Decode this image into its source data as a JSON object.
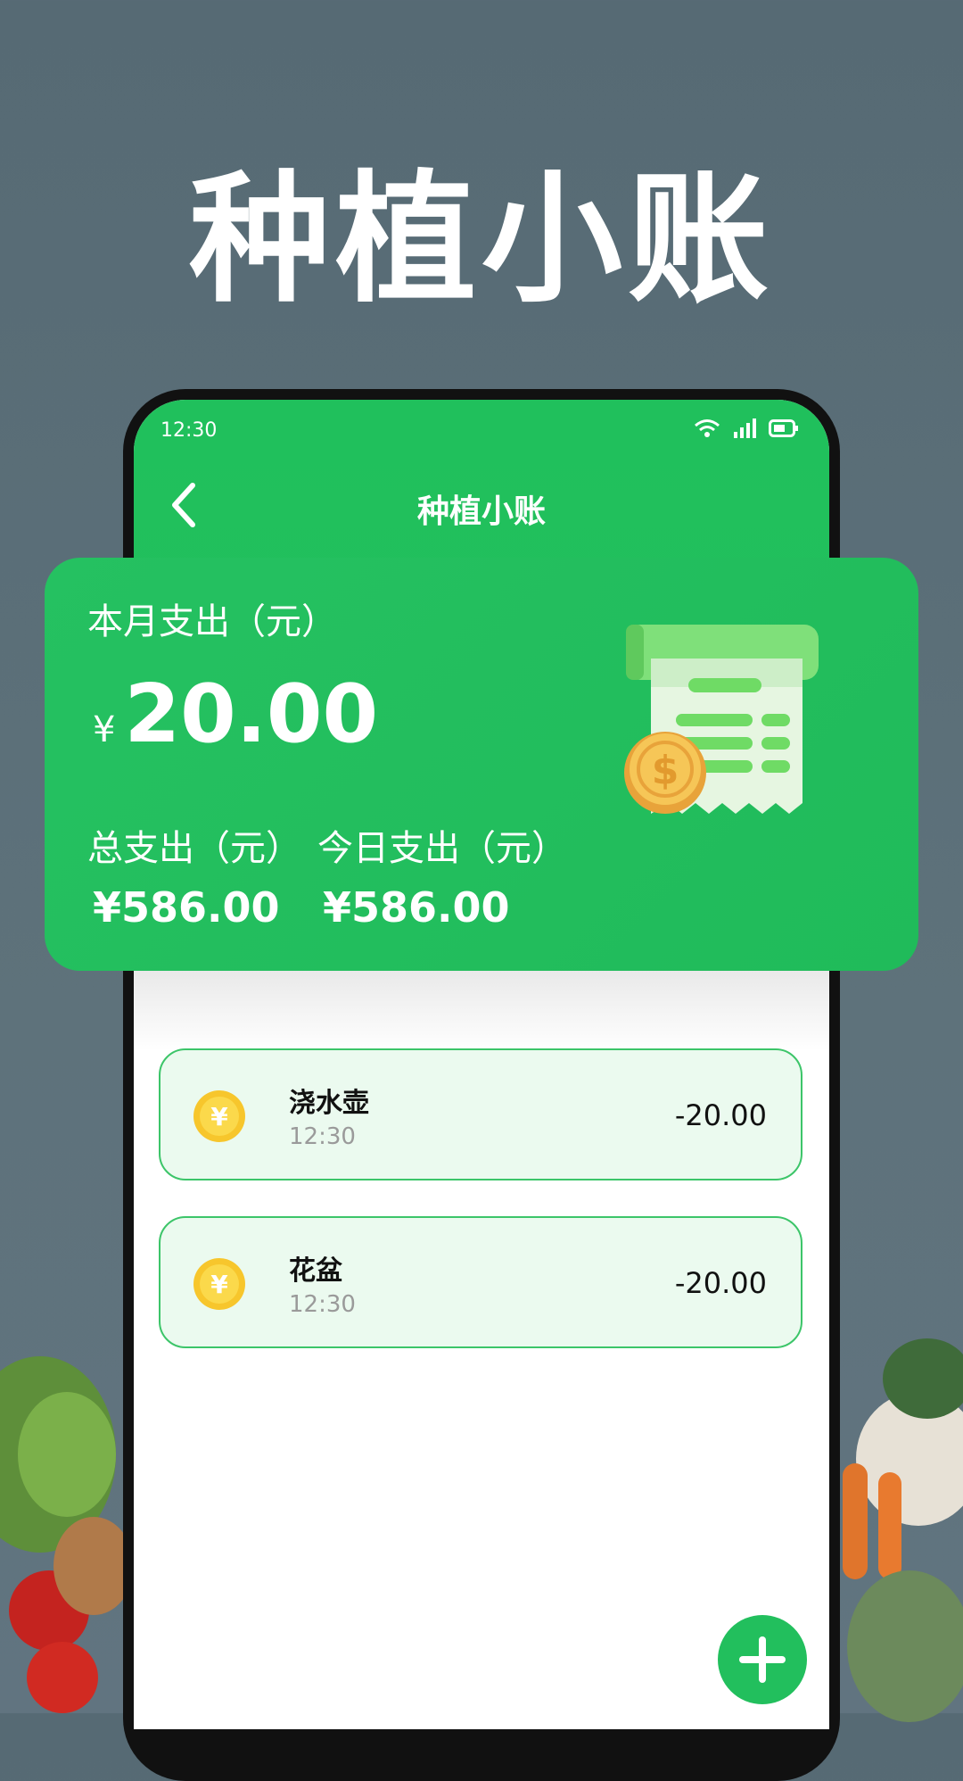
{
  "promo": {
    "headline": "种植小账"
  },
  "status_bar": {
    "time": "12:30",
    "icons": [
      "wifi-icon",
      "signal-icon",
      "battery-icon"
    ]
  },
  "nav": {
    "title": "种植小账",
    "back_icon": "chevron-left-icon"
  },
  "summary": {
    "month_label": "本月支出（元）",
    "currency_symbol": "¥",
    "month_value": "20.00",
    "total_label": "总支出（元）",
    "total_value": "¥586.00",
    "today_label": "今日支出（元）",
    "today_value": "¥586.00",
    "illustration": "receipt-coin-icon"
  },
  "entries": [
    {
      "name": "浇水壶",
      "time": "12:30",
      "amount": "-20.00",
      "icon": "yuan-coin-icon"
    },
    {
      "name": "花盆",
      "time": "12:30",
      "amount": "-20.00",
      "icon": "yuan-coin-icon"
    }
  ],
  "fab": {
    "icon": "plus-icon"
  },
  "colors": {
    "accent": "#22bf5d",
    "background": "#5a6e78",
    "entry_bg": "#ebfaef"
  }
}
